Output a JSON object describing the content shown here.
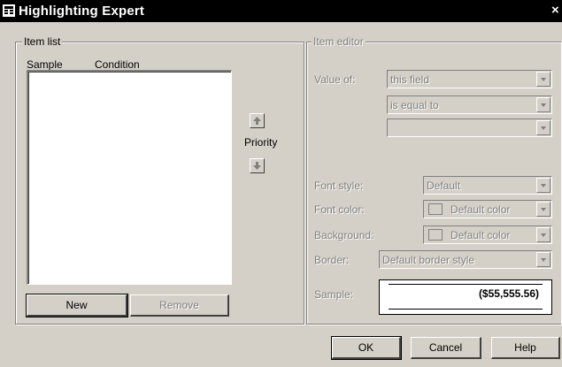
{
  "window": {
    "title": "Highlighting Expert",
    "close_glyph": "×"
  },
  "item_list": {
    "group_label": "Item list",
    "col_sample": "Sample",
    "col_condition": "Condition",
    "items": [],
    "new_button": "New",
    "remove_button": "Remove"
  },
  "priority": {
    "label": "Priority",
    "up_icon": "arrow-up-icon",
    "down_icon": "arrow-down-icon"
  },
  "item_editor": {
    "group_label": "Item editor",
    "value_of_label": "Value of:",
    "value_of_selected": "this field",
    "operator_selected": "is equal to",
    "value_selected": "",
    "font_style_label": "Font style:",
    "font_style_selected": "Default",
    "font_color_label": "Font color:",
    "font_color_selected": "Default color",
    "background_label": "Background:",
    "background_selected": "Default color",
    "border_label": "Border:",
    "border_selected": "Default border style",
    "sample_label": "Sample:",
    "sample_value": "($55,555.56)"
  },
  "footer": {
    "ok": "OK",
    "cancel": "Cancel",
    "help": "Help"
  },
  "colors": {
    "face": "#d4d0c8",
    "title_bar": "#000000",
    "disabled_text": "#808080"
  }
}
